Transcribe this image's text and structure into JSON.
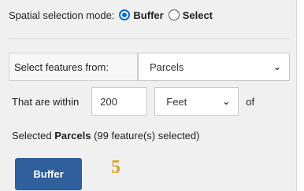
{
  "mode": {
    "label": "Spatial selection mode:",
    "options": [
      {
        "label": "Buffer",
        "checked": true
      },
      {
        "label": "Select",
        "checked": false
      }
    ]
  },
  "form": {
    "features_label": "Select features from:",
    "features_value": "Parcels",
    "within_label": "That are within",
    "distance_value": "200",
    "unit_value": "Feet",
    "of_label": "of"
  },
  "status": {
    "prefix": "Selected ",
    "layer": "Parcels",
    "suffix": " (99 feature(s) selected)"
  },
  "buffer_button_label": "Buffer",
  "step_marker": "5",
  "colors": {
    "accent": "#0a66d0",
    "button": "#2f5f9c",
    "step_marker": "#e0a020"
  }
}
